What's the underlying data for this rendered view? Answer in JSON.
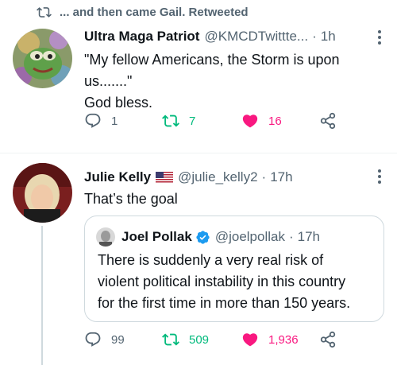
{
  "retweet_banner": {
    "text": "... and then came Gail. Retweeted"
  },
  "tweet1": {
    "author_name": "Ultra Maga Patriot",
    "handle": "@KMCDTwittte...",
    "time": "1h",
    "text_line1": "\"My fellow Americans, the Storm is upon",
    "text_line2": "us.......\"",
    "text_line3": "God bless.",
    "replies": "1",
    "retweets": "7",
    "likes": "16"
  },
  "tweet2": {
    "author_name": "Julie Kelly",
    "handle": "@julie_kelly2",
    "time": "17h",
    "text": "That’s the goal",
    "replies": "99",
    "retweets": "509",
    "likes": "1,936",
    "quote": {
      "author_name": "Joel Pollak",
      "handle": "@joelpollak",
      "time": "17h",
      "text_line1": "There is suddenly a very real risk of",
      "text_line2": "violent political instability in this country",
      "text_line3": "for the first time in more than 150 years."
    }
  },
  "colors": {
    "secondary": "#536471",
    "retweet": "#00ba7c",
    "like": "#f91880",
    "verified": "#1d9bf0",
    "border": "#cfd9de"
  },
  "icons": [
    "retweet-icon",
    "reply-icon",
    "like-icon",
    "share-icon",
    "more-icon",
    "verified-icon",
    "us-flag-icon"
  ]
}
